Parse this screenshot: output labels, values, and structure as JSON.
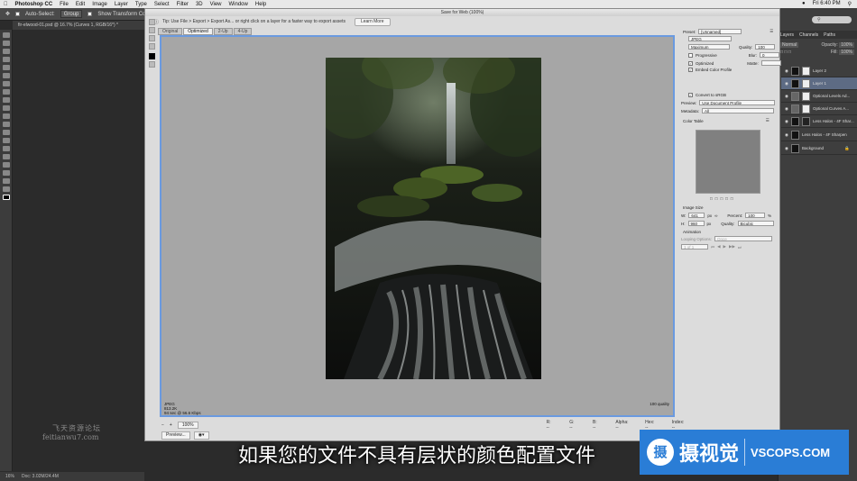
{
  "menubar": {
    "app": "Photoshop CC",
    "items": [
      "File",
      "Edit",
      "Image",
      "Layer",
      "Type",
      "Select",
      "Filter",
      "3D",
      "View",
      "Window",
      "Help"
    ],
    "clock": "Fri 6:40 PM"
  },
  "optionsbar": {
    "auto_select": "Auto-Select:",
    "group": "Group",
    "show_transform": "Show Transform Controls"
  },
  "doc_tab": "fir-elwood-01.psd @ 16.7% (Curves 1, RGB/16*) *",
  "statusbar": {
    "zoom": "16%",
    "doc": "Doc: 3.02M/24.4M"
  },
  "right_panel": {
    "tabs": [
      "Layers",
      "Channels",
      "Paths"
    ],
    "blend": "Normal",
    "opacity_label": "Opacity:",
    "opacity": "100%",
    "fill_label": "Fill:",
    "fill": "100%",
    "layers": [
      {
        "name": "Layer 2",
        "selected": false
      },
      {
        "name": "Layer 1",
        "selected": true
      },
      {
        "name": "Optional Levels Ad...",
        "selected": false
      },
      {
        "name": "Optional Curves A...",
        "selected": false
      },
      {
        "name": "Less Halos - 4F Shar...",
        "selected": false
      },
      {
        "name": "Less Halos - 4F Sharpen",
        "selected": false
      },
      {
        "name": "Background",
        "selected": false
      }
    ]
  },
  "watermark": {
    "line1": "飞天资源论坛",
    "line2": "feitianwu7.com"
  },
  "dialog": {
    "title": "Save for Web (100%)",
    "tip": "Tip: Use File > Export > Export As... or right click on a layer for a faster way to export assets",
    "learn_more": "Learn More",
    "view_tabs": [
      "Original",
      "Optimized",
      "2-Up",
      "4-Up"
    ],
    "info": {
      "format": "JPEG",
      "size": "813.2K",
      "time": "94 sec @ 56.6 Kbps",
      "quality": "100 quality"
    },
    "zoom": "100%",
    "preview": "Preview...",
    "readouts": {
      "r": "R: --",
      "g": "G: --",
      "b": "B: --",
      "alpha": "Alpha: --",
      "hex": "Hex: --",
      "index": "Index: --"
    }
  },
  "settings": {
    "preset_label": "Preset:",
    "preset": "[Unnamed]",
    "format": "JPEG",
    "compression": "Maximum",
    "quality_label": "Quality:",
    "quality": "100",
    "blur_label": "Blur:",
    "blur": "0",
    "matte_label": "Matte:",
    "progressive": "Progressive",
    "optimized": "Optimized",
    "embed_profile": "Embed Color Profile",
    "convert_srgb": "Convert to sRGB",
    "preview_label": "Preview:",
    "preview": "Use Document Profile",
    "metadata_label": "Metadata:",
    "metadata": "All",
    "color_table": "Color Table",
    "image_size": "Image Size",
    "w_label": "W:",
    "w": "641",
    "h_label": "H:",
    "h": "960",
    "unit": "px",
    "percent_label": "Percent:",
    "percent": "100",
    "percent_unit": "%",
    "quality2_label": "Quality:",
    "resample": "Bicubic",
    "animation": "Animation",
    "looping_label": "Looping Options:",
    "looping": "Once",
    "frame": "1 of 1"
  },
  "subtitle": "如果您的文件不具有层状的颜色配置文件",
  "logo": {
    "mark": "摄",
    "name": "摄视觉",
    "url": "VSCOPS.COM"
  }
}
